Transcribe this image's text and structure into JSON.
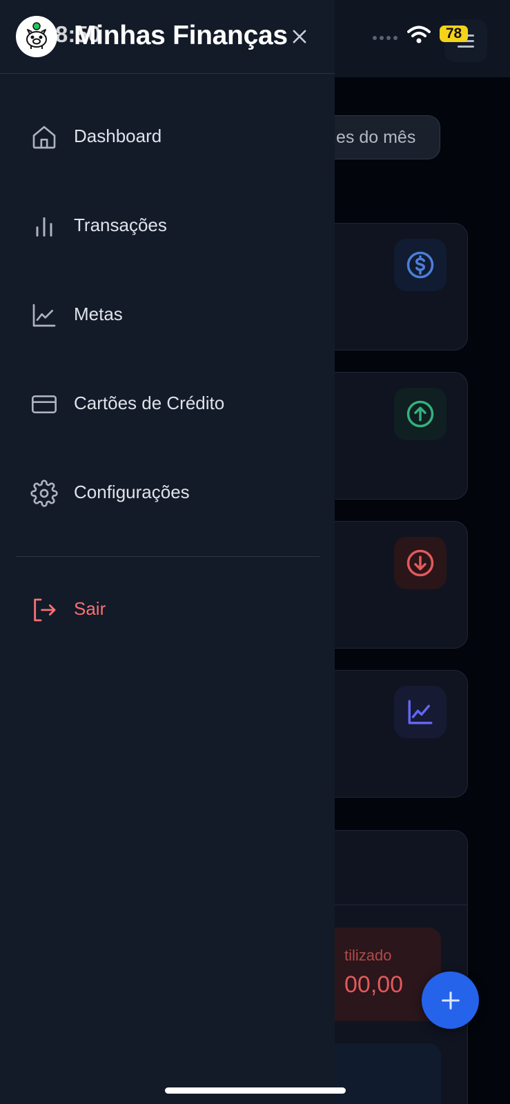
{
  "status_bar": {
    "time": "8:50",
    "battery": "78"
  },
  "drawer": {
    "title": "Minhas Finanças",
    "nav_items": [
      {
        "label": "Dashboard",
        "icon": "home-icon"
      },
      {
        "label": "Transações",
        "icon": "bar-chart-icon"
      },
      {
        "label": "Metas",
        "icon": "line-chart-icon"
      },
      {
        "label": "Cartões de Crédito",
        "icon": "credit-card-icon"
      },
      {
        "label": "Configurações",
        "icon": "gear-icon"
      }
    ],
    "logout": {
      "label": "Sair",
      "icon": "logout-icon"
    }
  },
  "background": {
    "month_button_label": "es do mês",
    "cards": [
      {
        "icon": "dollar-circle-icon",
        "color": "#4c7fd9"
      },
      {
        "icon": "arrow-up-circle-icon",
        "color": "#34b27b"
      },
      {
        "icon": "arrow-down-circle-icon",
        "color": "#e35a5a"
      },
      {
        "icon": "line-chart-icon",
        "color": "#6366f1"
      }
    ],
    "limit": {
      "label": "tilizado",
      "value": "00,00"
    }
  },
  "colors": {
    "drawer_bg": "#131a28",
    "danger": "#f87171",
    "fab": "#2563eb",
    "battery": "#f5d31a"
  }
}
